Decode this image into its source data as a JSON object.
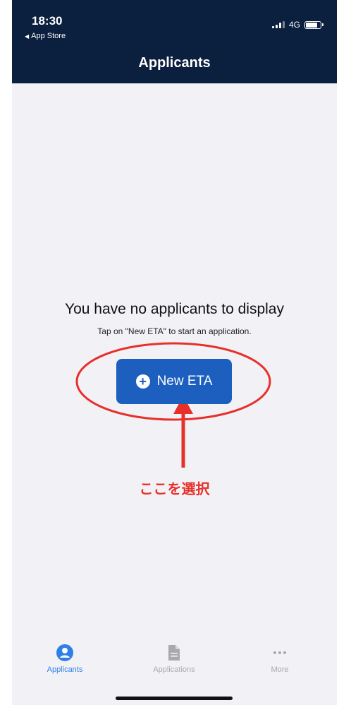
{
  "status_bar": {
    "time": "18:30",
    "back_app": "App Store",
    "network": "4G"
  },
  "nav": {
    "title": "Applicants"
  },
  "empty_state": {
    "title": "You have no applicants to display",
    "subtitle": "Tap on \"New ETA\" to start an application.",
    "button_label": "New ETA"
  },
  "annotation": {
    "text": "ここを選択",
    "color": "#e8302a"
  },
  "tabs": {
    "applicants": "Applicants",
    "applications": "Applications",
    "more": "More"
  },
  "colors": {
    "header_bg": "#0b1f3f",
    "button_bg": "#1c5fbe",
    "tab_active": "#2f7fe6",
    "tab_inactive": "#a9a9ad"
  },
  "icons": {
    "plus": "plus-circle-icon",
    "applicants_tab": "person-circle-icon",
    "applications_tab": "document-icon",
    "more_tab": "ellipsis-icon"
  }
}
